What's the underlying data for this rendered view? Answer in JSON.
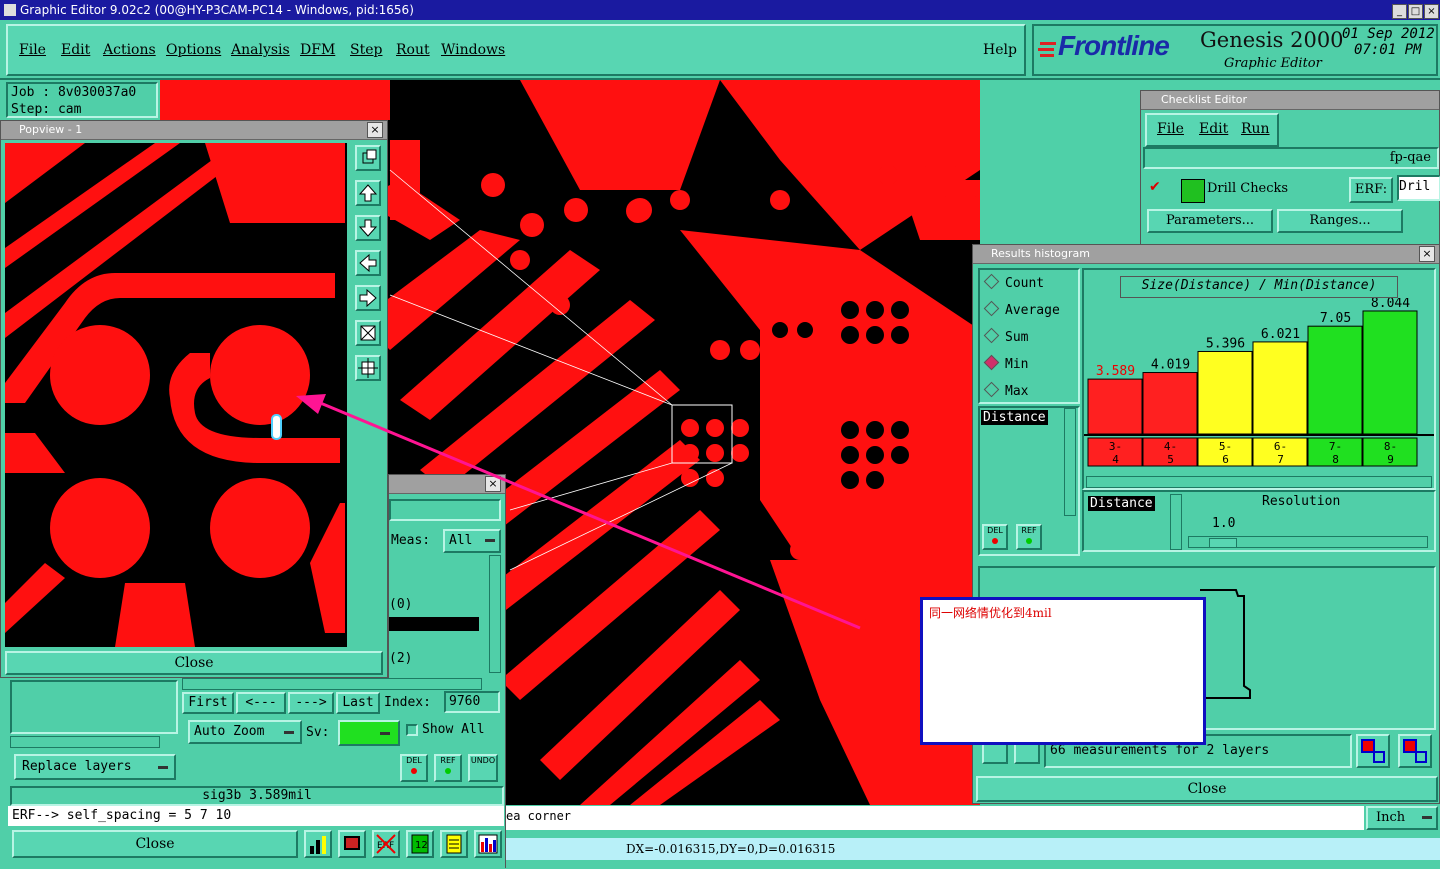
{
  "window": {
    "title": "Graphic Editor 9.02c2 (00@HY-P3CAM-PC14 - Windows, pid:1656)",
    "controls": [
      "_",
      "□",
      "×"
    ]
  },
  "menu": {
    "items": [
      "File",
      "Edit",
      "Actions",
      "Options",
      "Analysis",
      "DFM",
      "Step",
      "Rout",
      "Windows"
    ],
    "help": "Help"
  },
  "brand": {
    "logo": "Frontline",
    "product": "Genesis 2000",
    "subtitle": "Graphic Editor",
    "date": "01 Sep 2012",
    "time": "07:01 PM"
  },
  "job": {
    "job_line": "Job : 8v030037a0",
    "step_line": "Step: cam"
  },
  "popview": {
    "title": "Popview - 1",
    "close": "Close",
    "toolbar_icons": [
      "zoom-icon",
      "up-arrow-icon",
      "down-arrow-icon",
      "left-arrow-icon",
      "right-arrow-icon",
      "fit-icon",
      "pan-icon"
    ]
  },
  "checklist": {
    "title": "Checklist Editor",
    "menu": [
      "File",
      "Edit",
      "Run"
    ],
    "name": "fp-qae",
    "item": "Drill Checks",
    "erf_label": "ERF:",
    "erf_value": "Dril",
    "params": "Parameters...",
    "ranges": "Ranges..."
  },
  "histogram": {
    "title": "Results histogram",
    "header": "Size(Distance) / Min(Distance)",
    "options": [
      "Count",
      "Average",
      "Sum",
      "Min",
      "Max"
    ],
    "selected": "Min",
    "list_item": "Distance",
    "list2_item": "Distance",
    "resolution_label": "Resolution",
    "resolution_value": "1.0",
    "measurements": "66 measurements for 2 layers",
    "close": "Close",
    "del": "DEL",
    "ref": "REF"
  },
  "chart_data": {
    "type": "bar",
    "categories": [
      "3-4",
      "4-5",
      "5-6",
      "6-7",
      "7-8",
      "8-9"
    ],
    "values": [
      3.589,
      4.019,
      5.396,
      6.021,
      7.05,
      8.044
    ],
    "value_labels": [
      "3.589",
      "4.019",
      "5.396",
      "6.021",
      "7.05",
      "8.044"
    ],
    "title": "Size(Distance) / Min(Distance)",
    "colors": [
      "#ff2020",
      "#ff2020",
      "#ffff20",
      "#ffff20",
      "#20e020",
      "#20e020"
    ],
    "ylim": [
      0,
      8.5
    ]
  },
  "results": {
    "meas_label": "Meas:",
    "meas_value": "All",
    "list_line1": "(0)",
    "list_line2": "(2)",
    "first": "First",
    "prev": "<---",
    "next": "--->",
    "last": "Last",
    "index_label": "Index:",
    "index_value": "9760",
    "auto_zoom": "Auto Zoom",
    "sv_label": "Sv:",
    "show_all": "Show All",
    "replace_layers": "Replace layers",
    "status": "sig3b 3.589mil",
    "erf_line": "ERF--> self_spacing = 5 7 10",
    "close": "Close",
    "del": "DEL",
    "ref": "REF",
    "undo": "UNDO"
  },
  "statusbar": {
    "message": "ea corner",
    "units": "Inch",
    "coords": "DX=-0.016315,DY=0,D=0.016315"
  },
  "note": {
    "text": "同一网络情优化到4mil"
  }
}
